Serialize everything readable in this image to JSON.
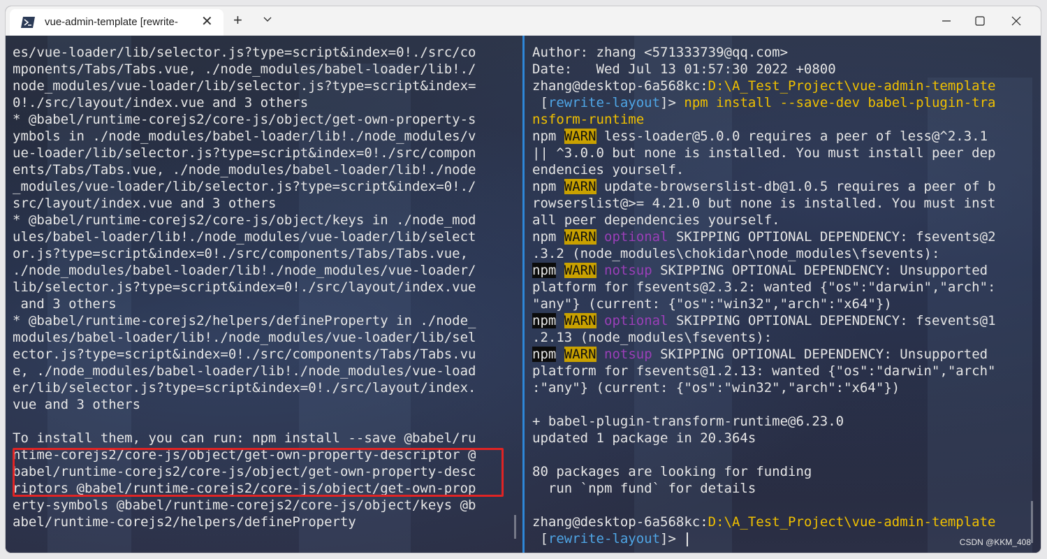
{
  "window": {
    "tab_title": "vue-admin-template [rewrite-",
    "new_tab_label": "+",
    "close_tab_label": "✕"
  },
  "left_pane": {
    "lines": [
      "es/vue-loader/lib/selector.js?type=script&index=0!./src/co",
      "mponents/Tabs/Tabs.vue, ./node_modules/babel-loader/lib!./",
      "node_modules/vue-loader/lib/selector.js?type=script&index=",
      "0!./src/layout/index.vue and 3 others",
      "* @babel/runtime-corejs2/core-js/object/get-own-property-s",
      "ymbols in ./node_modules/babel-loader/lib!./node_modules/v",
      "ue-loader/lib/selector.js?type=script&index=0!./src/compon",
      "ents/Tabs/Tabs.vue, ./node_modules/babel-loader/lib!./node",
      "_modules/vue-loader/lib/selector.js?type=script&index=0!./",
      "src/layout/index.vue and 3 others",
      "* @babel/runtime-corejs2/core-js/object/keys in ./node_mod",
      "ules/babel-loader/lib!./node_modules/vue-loader/lib/select",
      "or.js?type=script&index=0!./src/components/Tabs/Tabs.vue,",
      "./node_modules/babel-loader/lib!./node_modules/vue-loader/",
      "lib/selector.js?type=script&index=0!./src/layout/index.vue",
      " and 3 others",
      "* @babel/runtime-corejs2/helpers/defineProperty in ./node_",
      "modules/babel-loader/lib!./node_modules/vue-loader/lib/sel",
      "ector.js?type=script&index=0!./src/components/Tabs/Tabs.vu",
      "e, ./node_modules/babel-loader/lib!./node_modules/vue-load",
      "er/lib/selector.js?type=script&index=0!./src/layout/index.",
      "vue and 3 others",
      "",
      "To install them, you can run: npm install --save @babel/ru",
      "ntime-corejs2/core-js/object/get-own-property-descriptor @",
      "babel/runtime-corejs2/core-js/object/get-own-property-desc",
      "riptors @babel/runtime-corejs2/core-js/object/get-own-prop",
      "erty-symbols @babel/runtime-corejs2/core-js/object/keys @b",
      "abel/runtime-corejs2/helpers/defineProperty"
    ]
  },
  "right_pane": {
    "author_line": "Author: zhang <571333739@qq.com>",
    "date_line": "Date:   Wed Jul 13 01:57:30 2022 +0800",
    "prompt_user": "zhang@desktop-6a568kc:",
    "prompt_path": "D:\\A_Test_Project\\vue-admin-template",
    "prompt_branch_open": " [",
    "prompt_branch": "rewrite-layout",
    "prompt_branch_close": "]> ",
    "command_a": "npm install --save-dev babel-plugin-tra",
    "command_b": "nsform-runtime",
    "npm": "npm",
    "warn": "WARN",
    "warn1_a": " less-loader@5.0.0 requires a peer of less@^2.3.1",
    "warn1_b": "|| ^3.0.0 but none is installed. You must install peer dep",
    "warn1_c": "endencies yourself.",
    "warn2_a": " update-browserslist-db@1.0.5 requires a peer of b",
    "warn2_b": "rowserslist@>= 4.21.0 but none is installed. You must inst",
    "warn2_c": "all peer dependencies yourself.",
    "optional": "optional",
    "notsup": "notsup",
    "opt1_a": " SKIPPING OPTIONAL DEPENDENCY: fsevents@2",
    "opt1_b": ".3.2 (node_modules\\chokidar\\node_modules\\fsevents):",
    "ns1_a": " SKIPPING OPTIONAL DEPENDENCY: Unsupported",
    "ns1_b": "platform for fsevents@2.3.2: wanted {\"os\":\"darwin\",\"arch\":",
    "ns1_c": "\"any\"} (current: {\"os\":\"win32\",\"arch\":\"x64\"})",
    "opt2_a": " SKIPPING OPTIONAL DEPENDENCY: fsevents@1",
    "opt2_b": ".2.13 (node_modules\\fsevents):",
    "ns2_a": " SKIPPING OPTIONAL DEPENDENCY: Unsupported",
    "ns2_b": "platform for fsevents@1.2.13: wanted {\"os\":\"darwin\",\"arch\"",
    "ns2_c": ":\"any\"} (current: {\"os\":\"win32\",\"arch\":\"x64\"})",
    "result1": "+ babel-plugin-transform-runtime@6.23.0",
    "result2": "updated 1 package in 20.364s",
    "funding1": "80 packages are looking for funding",
    "funding2": "  run `npm fund` for details"
  },
  "watermark": "CSDN @KKM_408",
  "colors": {
    "divider": "#2e87d8",
    "highlight_box": "#e02424",
    "warn_bg": "#c9a100",
    "path_yellow": "#f0c000",
    "branch_cyan": "#4fa6e6",
    "optional_magenta": "#9b3fb8"
  }
}
